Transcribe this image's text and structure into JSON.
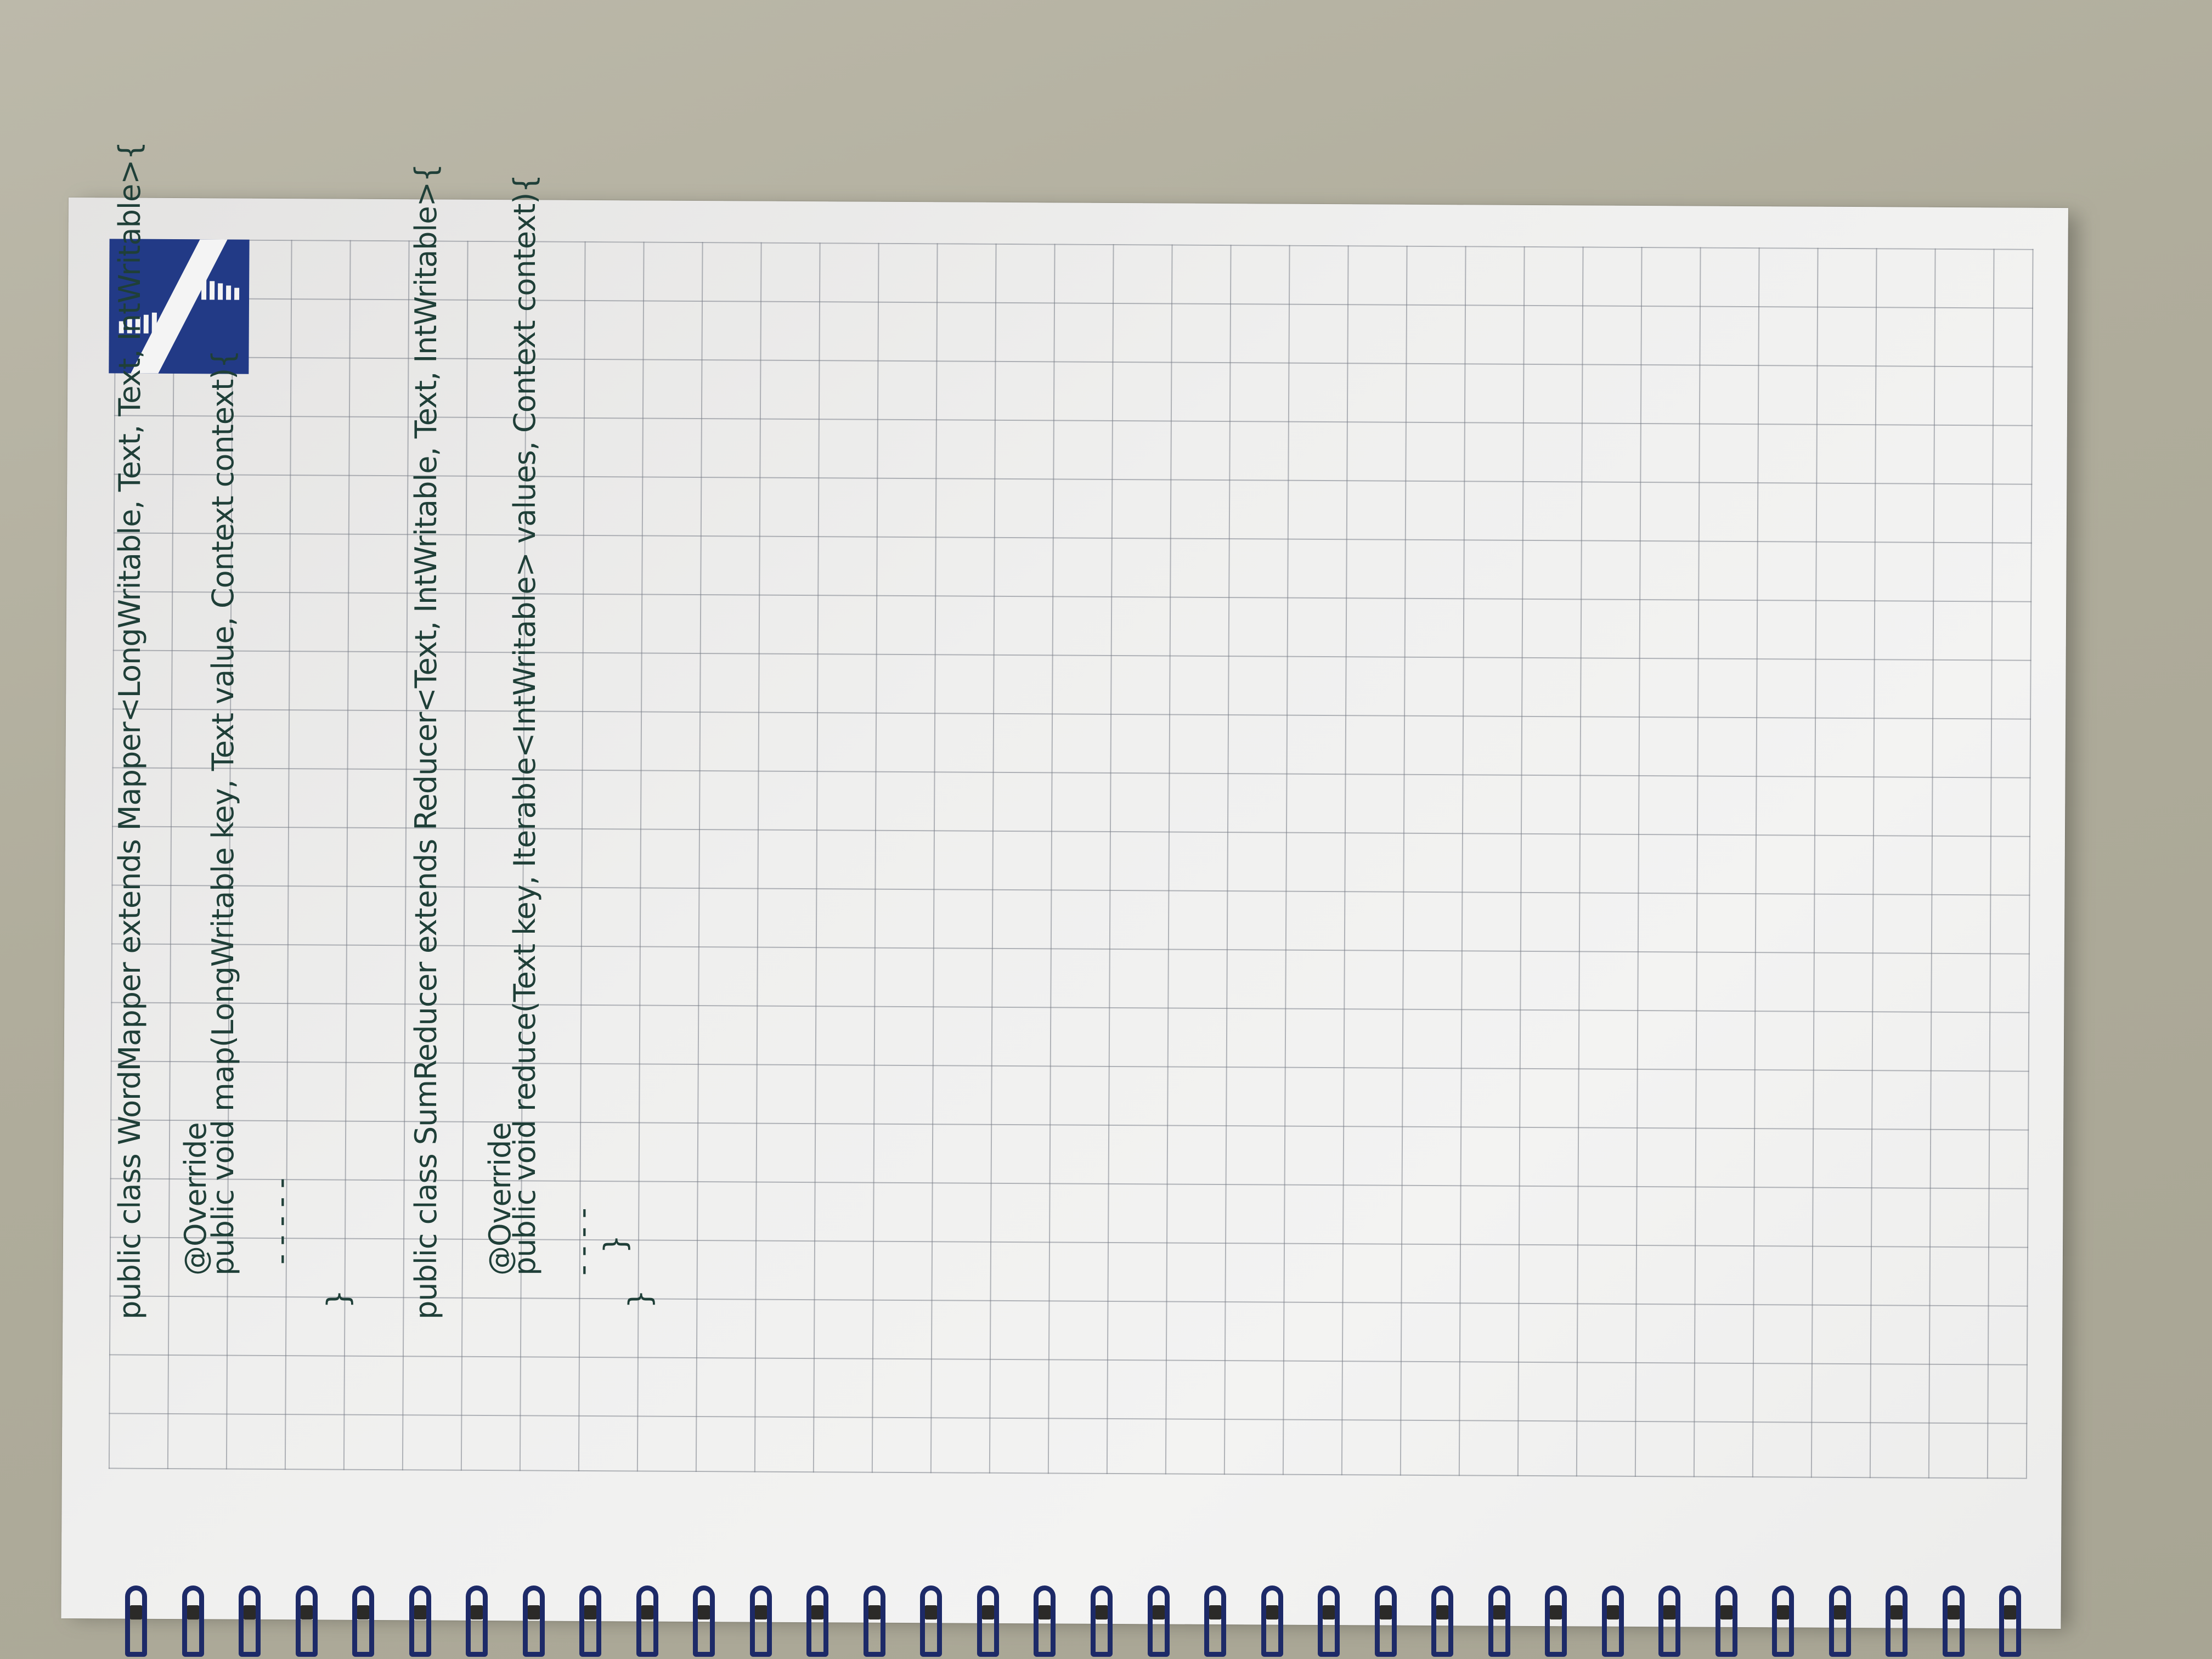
{
  "notebook": {
    "logo_icon": "notebook-brand-logo-icon",
    "logo_color": "#223a86",
    "ink_color": "#1f3f38",
    "code_lines": [
      "public class WordMapper extends Mapper<LongWritable, Text, Text, IntWritable>{",
      "@Override",
      "public void map(LongWritable key, Text value, Context context){",
      "- - - - -",
      "}",
      "public class SumReducer extends Reducer<Text, IntWritable, Text, IntWritable>{",
      "@Override",
      "public void reduce(Text key, Iterable<IntWritable> values, Context context){",
      "- - - -",
      "}",
      "}"
    ],
    "spiral_ring_count": 34
  }
}
